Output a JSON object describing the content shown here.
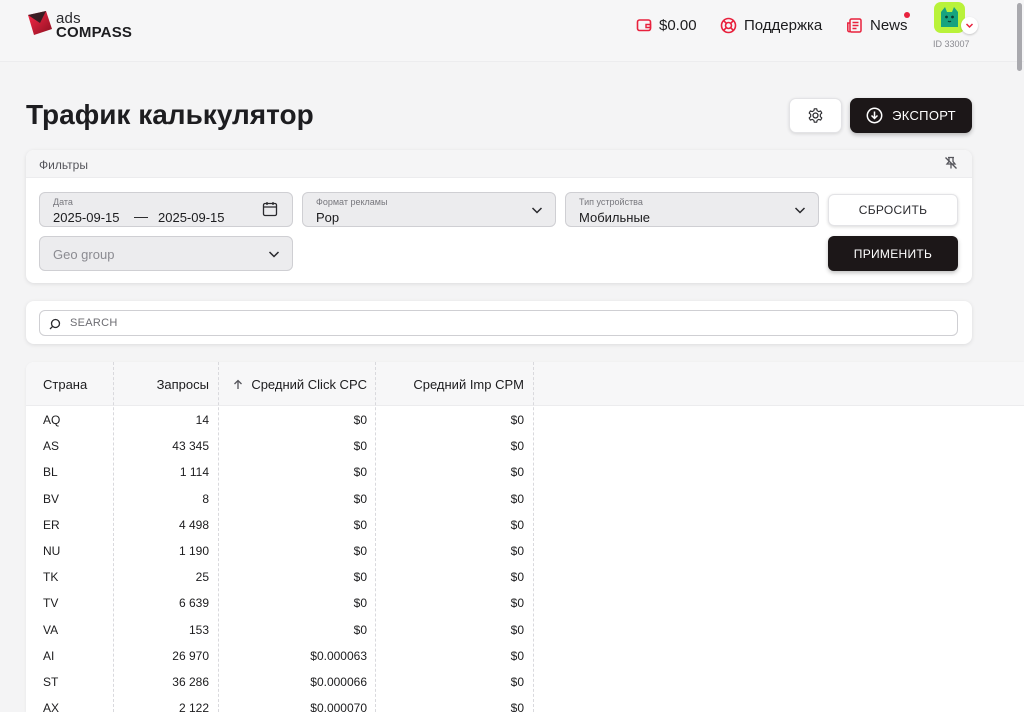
{
  "brand": {
    "top": "ads",
    "bottom": "COMPASS"
  },
  "header": {
    "balance": "$0.00",
    "support": "Поддержка",
    "news": "News",
    "user_id": "ID 33007"
  },
  "page": {
    "title": "Трафик калькулятор",
    "export_label": "ЭКСПОРТ"
  },
  "filters": {
    "title": "Фильтры",
    "date": {
      "label": "Дата",
      "from": "2025-09-15",
      "separator": "—",
      "to": "2025-09-15"
    },
    "format": {
      "label": "Формат рекламы",
      "value": "Pop"
    },
    "device": {
      "label": "Тип устройства",
      "value": "Мобильные"
    },
    "geo": {
      "placeholder": "Geo group"
    },
    "reset_label": "СБРОСИТЬ",
    "apply_label": "ПРИМЕНИТЬ"
  },
  "search": {
    "placeholder": "SEARCH"
  },
  "table": {
    "columns": [
      "Страна",
      "Запросы",
      "Средний Click CPC",
      "Средний Imp CPM"
    ],
    "sort": {
      "column": "Средний Click CPC",
      "direction": "asc"
    },
    "rows": [
      [
        "AQ",
        "14",
        "$0",
        "$0"
      ],
      [
        "AS",
        "43 345",
        "$0",
        "$0"
      ],
      [
        "BL",
        "1 114",
        "$0",
        "$0"
      ],
      [
        "BV",
        "8",
        "$0",
        "$0"
      ],
      [
        "ER",
        "4 498",
        "$0",
        "$0"
      ],
      [
        "NU",
        "1 190",
        "$0",
        "$0"
      ],
      [
        "TK",
        "25",
        "$0",
        "$0"
      ],
      [
        "TV",
        "6 639",
        "$0",
        "$0"
      ],
      [
        "VA",
        "153",
        "$0",
        "$0"
      ],
      [
        "AI",
        "26 970",
        "$0.000063",
        "$0"
      ],
      [
        "ST",
        "36 286",
        "$0.000066",
        "$0"
      ],
      [
        "AX",
        "2 122",
        "$0.000070",
        "$0"
      ]
    ]
  },
  "colors": {
    "accent": "#e8213d",
    "dark_button": "#1c1718",
    "avatar_bg": "#b9f23a"
  }
}
